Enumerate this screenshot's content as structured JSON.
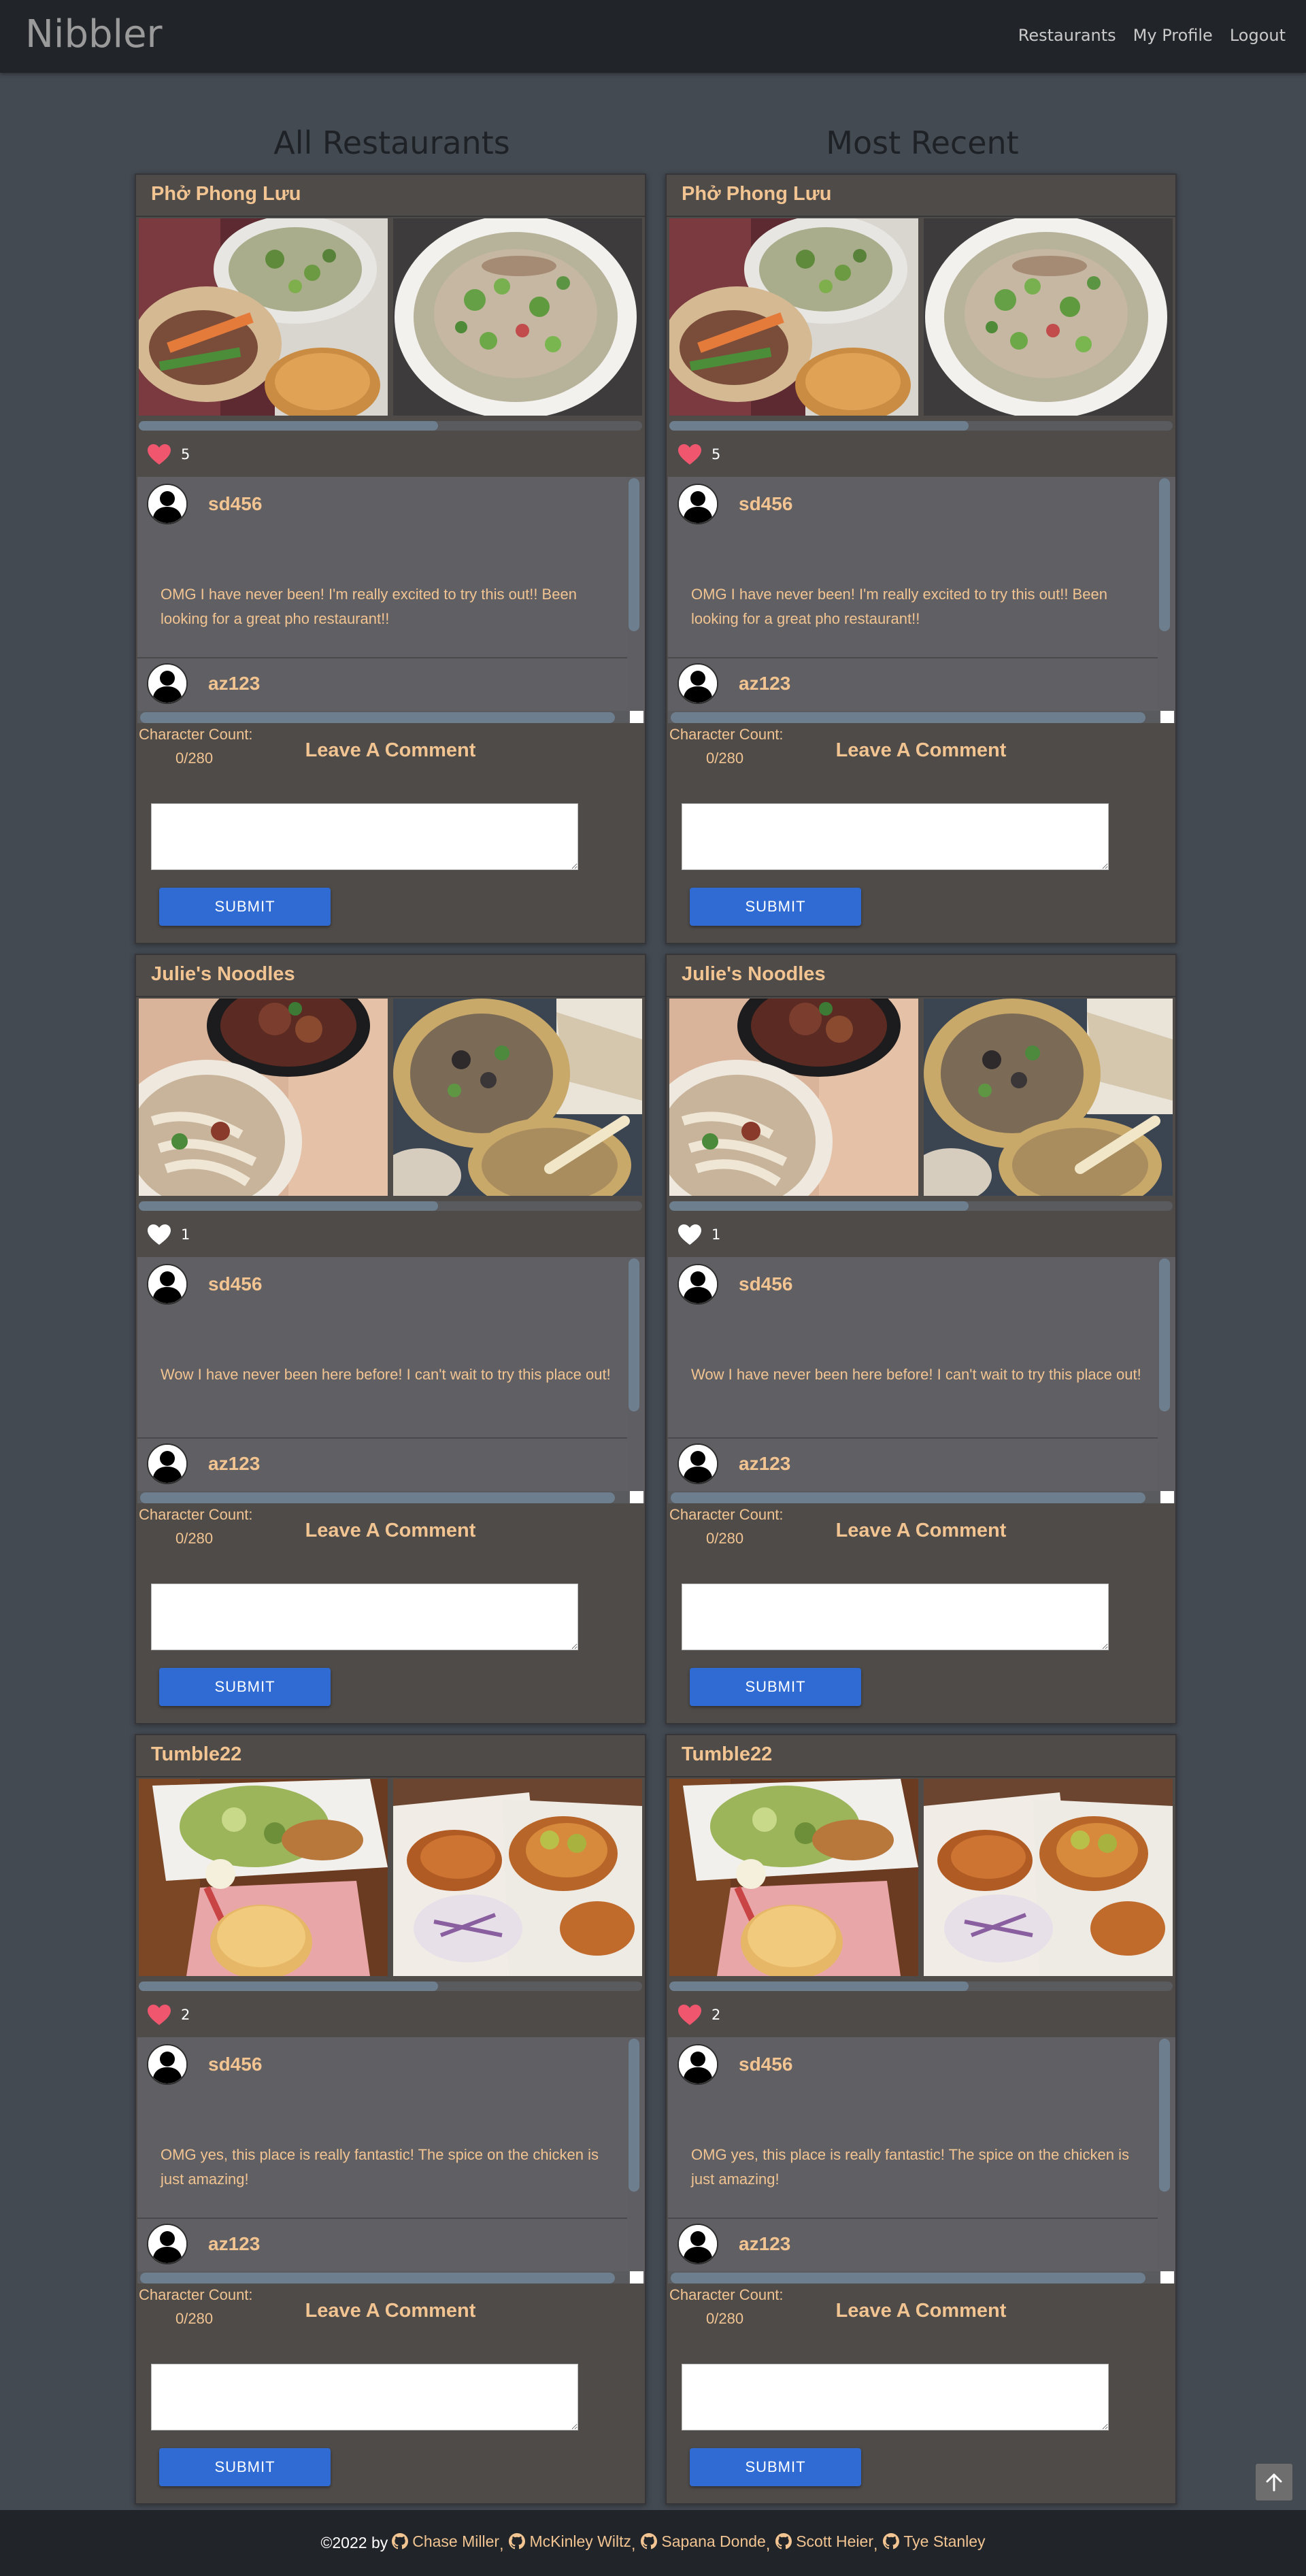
{
  "navbar": {
    "brand": "Nibbler",
    "links": [
      "Restaurants",
      "My Profile",
      "Logout"
    ]
  },
  "columns": [
    {
      "heading": "All Restaurants"
    },
    {
      "heading": "Most Recent"
    }
  ],
  "restaurants": [
    {
      "name": "Phở Phong Lưu",
      "likes": "5",
      "liked": true,
      "comments": [
        {
          "user": "sd456",
          "text": "OMG I have never been! I'm really excited to try this out!! Been looking for a great pho restaurant!!"
        },
        {
          "user": "az123",
          "text": ""
        }
      ],
      "photos": [
        "pho-sandwich-photo",
        "pho-bowl-photo"
      ]
    },
    {
      "name": "Julie's Noodles",
      "likes": "1",
      "liked": false,
      "comments": [
        {
          "user": "sd456",
          "text": "Wow I have never been here before! I can't wait to try this place out!"
        },
        {
          "user": "az123",
          "text": ""
        }
      ],
      "photos": [
        "noodle-dishes-photo",
        "noodle-soup-photo"
      ]
    },
    {
      "name": "Tumble22",
      "likes": "2",
      "liked": true,
      "comments": [
        {
          "user": "sd456",
          "text": "OMG yes, this place is really fantastic! The spice on the chicken is just amazing!"
        },
        {
          "user": "az123",
          "text": ""
        }
      ],
      "photos": [
        "chicken-sandwich-photo",
        "fried-chicken-photo"
      ]
    }
  ],
  "comment_form": {
    "char_count_label": "Character Count:",
    "char_count_value": "0/280",
    "heading": "Leave A Comment",
    "submit_label": "SUBMIT"
  },
  "footer": {
    "copyright": "©2022 by",
    "authors": [
      "Chase Miller",
      "McKinley Wiltz",
      "Sapana Donde",
      "Scott Heier",
      "Tye Stanley"
    ]
  },
  "colors": {
    "accent": "#f2c492",
    "heart_liked": "#f0576e",
    "heart_unliked": "#ffffff",
    "submit": "#2f6bd3"
  }
}
